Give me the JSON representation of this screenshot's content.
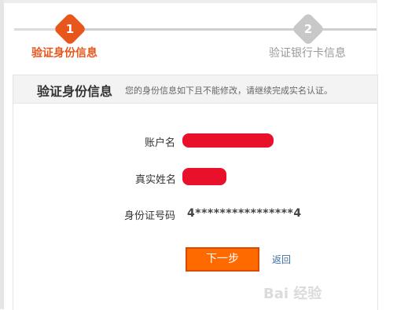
{
  "steps": [
    {
      "number": "1",
      "label": "验证身份信息",
      "state": "active",
      "color": "#e8561c"
    },
    {
      "number": "2",
      "label": "验证银行卡信息",
      "state": "inactive",
      "color": "#c8c8c8"
    }
  ],
  "panel": {
    "title": "验证身份信息",
    "subtitle": "您的身份信息如下且不能修改，请继续完成实名认证。"
  },
  "fields": {
    "account_label": "账户名",
    "realname_label": "真实姓名",
    "idnumber_label": "身份证号码",
    "idnumber_value": "4****************4"
  },
  "actions": {
    "next_label": "下一步",
    "back_label": "返回"
  },
  "watermark": "Bai 经验",
  "colors": {
    "accent": "#ff6a00",
    "redaction": "#e8102a",
    "link": "#3a6ea5"
  }
}
